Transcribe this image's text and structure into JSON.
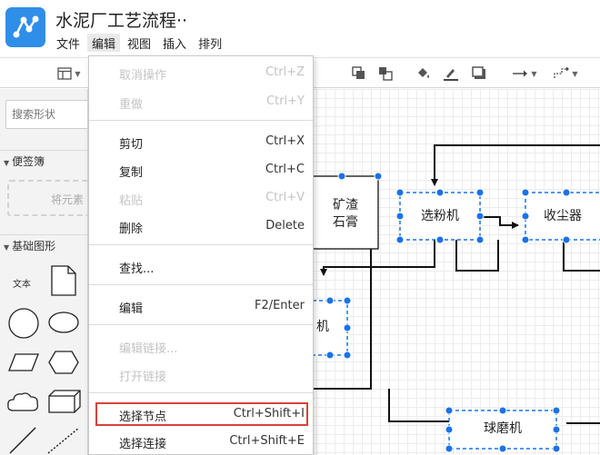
{
  "app": {
    "logo_icon": "flowchart-logo-icon",
    "document_title": "水泥厂工艺流程··",
    "accent_color": "#2f8ee8"
  },
  "menubar": {
    "items": [
      "文件",
      "编辑",
      "视图",
      "插入",
      "排列"
    ],
    "active": "编辑"
  },
  "toolbar": {
    "icons": [
      "panel-toggle-icon",
      "to-front-icon",
      "to-back-icon",
      "fill-color-icon",
      "line-color-icon",
      "shadow-icon",
      "connection-arrow-icon",
      "waypoints-icon"
    ]
  },
  "sidebar": {
    "search_placeholder": "搜索形状",
    "scratchpad_title": "便签簿",
    "scratchpad_hint": "将元素",
    "general_title": "基础图形",
    "shape_text_label": "文本",
    "shapes": [
      "text-shape",
      "page-shape",
      "circle-shape",
      "ellipse-shape",
      "parallelogram-shape",
      "hexagon-shape",
      "cloud-shape",
      "cube-shape",
      "line-shape",
      "dashed-line-shape"
    ]
  },
  "edit_menu": {
    "items": [
      {
        "label": "取消操作",
        "shortcut": "Ctrl+Z",
        "disabled": true
      },
      {
        "label": "重做",
        "shortcut": "Ctrl+Y",
        "disabled": true
      },
      {
        "label": "剪切",
        "shortcut": "Ctrl+X",
        "disabled": false
      },
      {
        "label": "复制",
        "shortcut": "Ctrl+C",
        "disabled": false
      },
      {
        "label": "粘贴",
        "shortcut": "Ctrl+V",
        "disabled": true
      },
      {
        "label": "删除",
        "shortcut": "Delete",
        "disabled": false
      },
      {
        "label": "查找...",
        "shortcut": "",
        "disabled": false
      },
      {
        "label": "编辑",
        "shortcut": "F2/Enter",
        "disabled": false
      },
      {
        "label": "编辑链接...",
        "shortcut": "",
        "disabled": true
      },
      {
        "label": "打开链接",
        "shortcut": "",
        "disabled": true
      },
      {
        "label": "选择节点",
        "shortcut": "Ctrl+Shift+I",
        "disabled": false
      },
      {
        "label": "选择连接",
        "shortcut": "Ctrl+Shift+E",
        "disabled": false
      }
    ],
    "highlight_color": "#d9413b"
  },
  "diagram": {
    "nodes": [
      {
        "label_line1": "矿渣",
        "label_line2": "石膏"
      },
      {
        "label": "选粉机"
      },
      {
        "label": "收尘器"
      },
      {
        "label": "机"
      },
      {
        "label": "球磨机"
      }
    ],
    "selection_color": "#1a73e8"
  }
}
